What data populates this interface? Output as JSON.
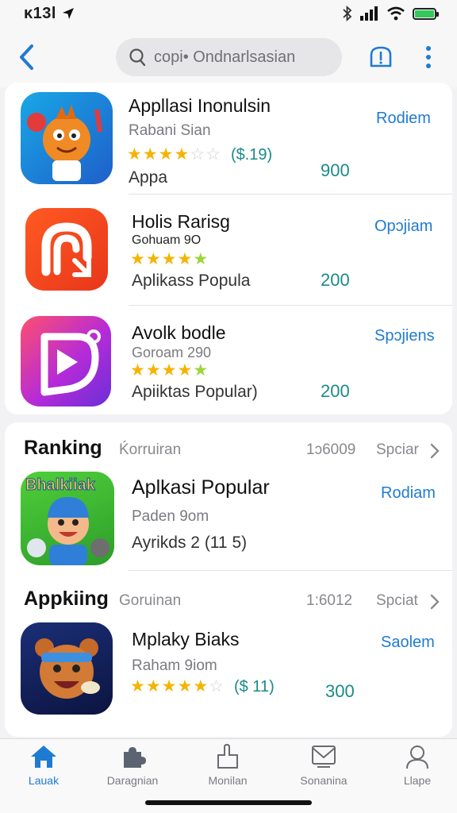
{
  "status_bar": {
    "time": "ᴋ13l"
  },
  "header": {
    "search_placeholder": "ᴄopi• Ondnarlsasian"
  },
  "top_apps": [
    {
      "title": "Appllasi Inonulsin",
      "subtitle": "Rabani Sian",
      "meta": "Appa",
      "price": "($.19)",
      "action": "Rodiem",
      "count": "900",
      "stars": [
        1,
        1,
        1,
        1,
        0,
        0
      ]
    },
    {
      "title": "Holis Rarisg",
      "subtitle": "Gohuam 9O",
      "meta": "Aplikass   Popula",
      "action": "Opɔjiam",
      "count": "200",
      "stars": [
        1,
        1,
        1,
        1,
        2
      ]
    },
    {
      "title": "Avolk bodle",
      "subtitle": "Goroam 290",
      "meta": "Apiiktas   Popular)",
      "action": "Spɔjiens",
      "count": "200",
      "stars": [
        1,
        1,
        1,
        1,
        2
      ]
    }
  ],
  "sections": [
    {
      "title": "Ranking",
      "subtitle": "Ḱorruiran",
      "number": "1ɔ6009",
      "link": "Spciar",
      "app": {
        "title": "Aplkasi Popular",
        "subtitle": "Paden 9om",
        "meta": "Ayrikds   2   (11 5)",
        "action": "Rodiam",
        "icon_text": "Bhalkiiak"
      }
    },
    {
      "title": "Appkiing",
      "subtitle": "Goruinan",
      "number": "1:6012",
      "link": "Spciat",
      "app": {
        "title": "Mplaky Biaks",
        "subtitle": "Raham 9iom",
        "price": "($ 11)",
        "action": "Saolem",
        "count": "300",
        "stars": [
          1,
          1,
          1,
          1,
          1,
          0
        ]
      }
    }
  ],
  "tabbar": [
    {
      "label": "Lauak",
      "icon": "home-icon",
      "active": true
    },
    {
      "label": "Daragnian",
      "icon": "puzzle-icon",
      "active": false
    },
    {
      "label": "Monilan",
      "icon": "arcade-icon",
      "active": false
    },
    {
      "label": "Sonanina",
      "icon": "inbox-icon",
      "active": false
    },
    {
      "label": "Llape",
      "icon": "profile-icon",
      "active": false
    }
  ],
  "colors": {
    "accent": "#1f7bd2",
    "count": "#1a8a8a",
    "star": "#f4b400"
  }
}
